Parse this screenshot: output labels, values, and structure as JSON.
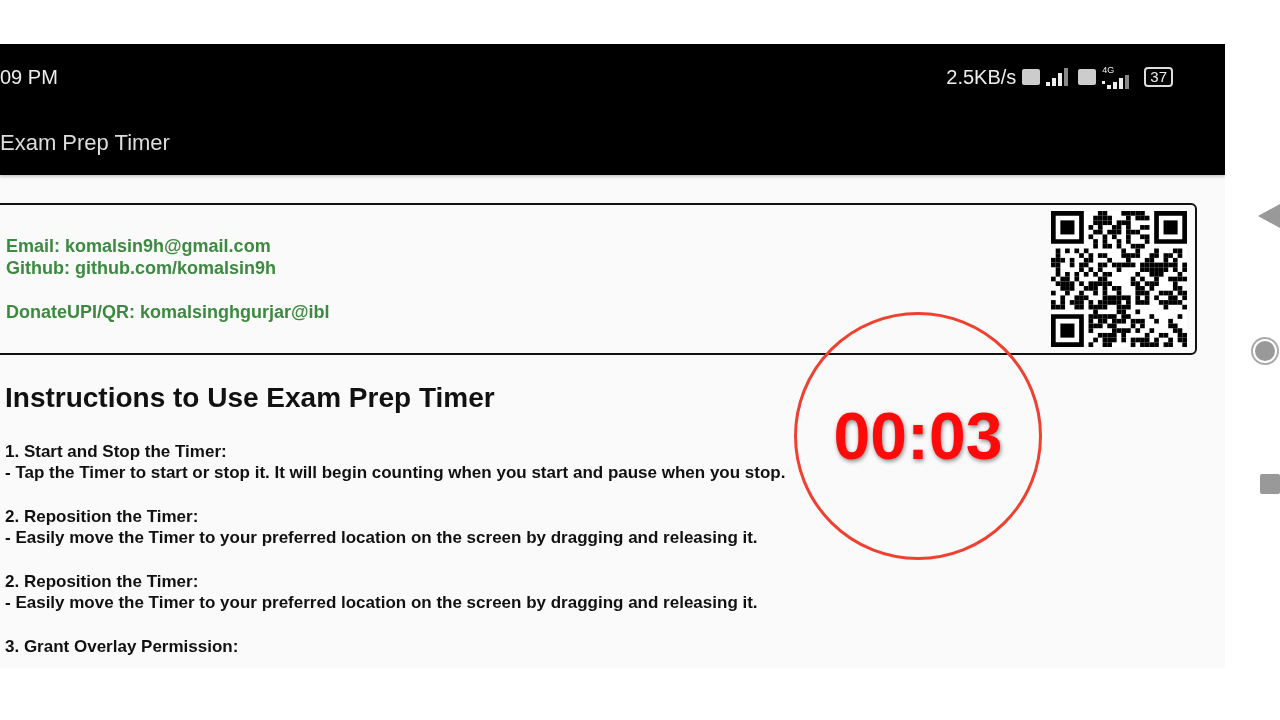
{
  "status_bar": {
    "time": "09 PM",
    "net_speed": "2.5KB/s",
    "network_type": "4G",
    "battery": "37"
  },
  "app_bar": {
    "title": "Exam Prep Timer"
  },
  "contact_card": {
    "groups": [
      {
        "lines": [
          "Email: komalsin9h@gmail.com",
          "Github: github.com/komalsin9h"
        ]
      },
      {
        "lines": [
          "DonateUPI/QR: komalsinghgurjar@ibl"
        ]
      }
    ]
  },
  "instructions": {
    "heading": "Instructions to Use Exam Prep Timer",
    "steps": [
      {
        "title": "1. Start and Stop the Timer:",
        "detail": "- Tap the Timer to start or stop it. It will begin counting when you start and pause when you stop."
      },
      {
        "title": "2. Reposition the Timer:",
        "detail": "- Easily move the Timer to your preferred location on the screen by dragging and releasing it."
      },
      {
        "title": "2. Reposition the Timer:",
        "detail": "- Easily move the Timer to your preferred location on the screen by dragging and releasing it."
      },
      {
        "title": "3. Grant Overlay Permission:"
      }
    ]
  },
  "timer_overlay": {
    "time": "00:03"
  }
}
